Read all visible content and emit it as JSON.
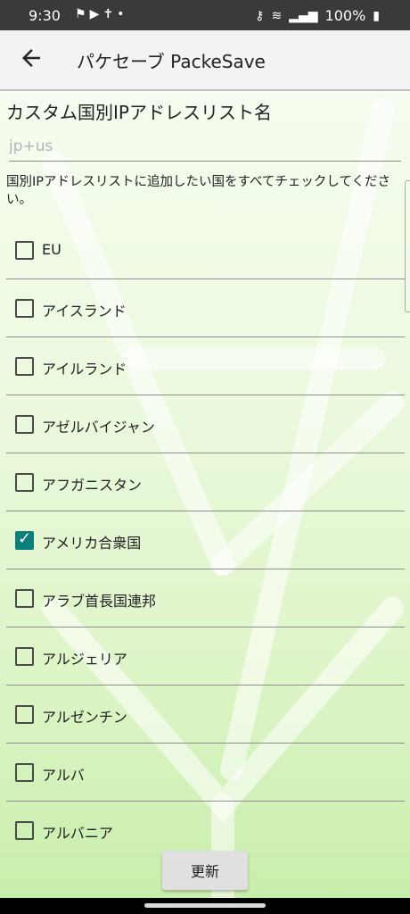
{
  "status_bar": {
    "time": "9:30",
    "left_icons": [
      "notification-icon",
      "youtube-icon",
      "accessibility-icon",
      "dot-icon"
    ],
    "battery_percent": "100%"
  },
  "app_bar": {
    "back_icon": "arrow-left-icon",
    "title": "パケセーブ  PackeSave"
  },
  "form": {
    "heading": "カスタム国別IPアドレスリスト名",
    "name_placeholder": "jp+us",
    "name_value": "",
    "instruction": "国別IPアドレスリストに追加したい国をすべてチェックしてください。"
  },
  "countries": [
    {
      "label": "EU",
      "checked": false
    },
    {
      "label": "アイスランド",
      "checked": false
    },
    {
      "label": "アイルランド",
      "checked": false
    },
    {
      "label": "アゼルバイジャン",
      "checked": false
    },
    {
      "label": "アフガニスタン",
      "checked": false
    },
    {
      "label": "アメリカ合衆国",
      "checked": true
    },
    {
      "label": "アラブ首長国連邦",
      "checked": false
    },
    {
      "label": "アルジェリア",
      "checked": false
    },
    {
      "label": "アルゼンチン",
      "checked": false
    },
    {
      "label": "アルバ",
      "checked": false
    },
    {
      "label": "アルバニア",
      "checked": false
    }
  ],
  "update_button": {
    "label": "更新"
  },
  "colors": {
    "accent": "#0d7f7b",
    "background_green": "#d6f2bf"
  }
}
